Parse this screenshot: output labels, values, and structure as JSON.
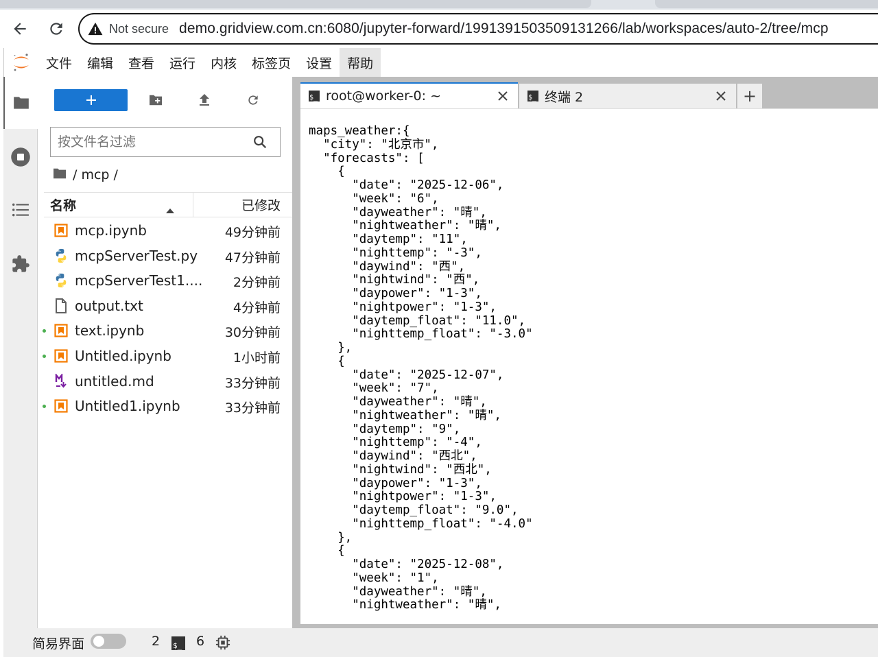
{
  "browser": {
    "not_secure_label": "Not secure",
    "url": "demo.gridview.com.cn:6080/jupyter-forward/1991391503509131266/lab/workspaces/auto-2/tree/mcp"
  },
  "menu": {
    "items": [
      "文件",
      "编辑",
      "查看",
      "运行",
      "内核",
      "标签页",
      "设置",
      "帮助"
    ],
    "active_item": "帮助"
  },
  "filebrowser": {
    "filter_placeholder": "按文件名过滤",
    "breadcrumb": "/ mcp /",
    "header_name": "名称",
    "header_modified": "已修改",
    "files": [
      {
        "name": "mcp.ipynb",
        "modified": "49分钟前",
        "type": "notebook",
        "running": false
      },
      {
        "name": "mcpServerTest.py",
        "modified": "47分钟前",
        "type": "python",
        "running": false
      },
      {
        "name": "mcpServerTest1....",
        "modified": "2分钟前",
        "type": "python",
        "running": false
      },
      {
        "name": "output.txt",
        "modified": "4分钟前",
        "type": "text",
        "running": false
      },
      {
        "name": "text.ipynb",
        "modified": "30分钟前",
        "type": "notebook",
        "running": true
      },
      {
        "name": "Untitled.ipynb",
        "modified": "1小时前",
        "type": "notebook",
        "running": true
      },
      {
        "name": "untitled.md",
        "modified": "33分钟前",
        "type": "markdown",
        "running": false
      },
      {
        "name": "Untitled1.ipynb",
        "modified": "33分钟前",
        "type": "notebook",
        "running": true
      }
    ]
  },
  "tabs": {
    "current": "root@worker-0: ~",
    "other": "终端 2",
    "add_label": "+"
  },
  "terminal": {
    "lines": [
      "maps_weather:{",
      "  \"city\": \"北京市\",",
      "  \"forecasts\": [",
      "    {",
      "      \"date\": \"2025-12-06\",",
      "      \"week\": \"6\",",
      "      \"dayweather\": \"晴\",",
      "      \"nightweather\": \"晴\",",
      "      \"daytemp\": \"11\",",
      "      \"nighttemp\": \"-3\",",
      "      \"daywind\": \"西\",",
      "      \"nightwind\": \"西\",",
      "      \"daypower\": \"1-3\",",
      "      \"nightpower\": \"1-3\",",
      "      \"daytemp_float\": \"11.0\",",
      "      \"nighttemp_float\": \"-3.0\"",
      "    },",
      "    {",
      "      \"date\": \"2025-12-07\",",
      "      \"week\": \"7\",",
      "      \"dayweather\": \"晴\",",
      "      \"nightweather\": \"晴\",",
      "      \"daytemp\": \"9\",",
      "      \"nighttemp\": \"-4\",",
      "      \"daywind\": \"西北\",",
      "      \"nightwind\": \"西北\",",
      "      \"daypower\": \"1-3\",",
      "      \"nightpower\": \"1-3\",",
      "      \"daytemp_float\": \"9.0\",",
      "      \"nighttemp_float\": \"-4.0\"",
      "    },",
      "    {",
      "      \"date\": \"2025-12-08\",",
      "      \"week\": \"1\",",
      "      \"dayweather\": \"晴\",",
      "      \"nightweather\": \"晴\","
    ]
  },
  "statusbar": {
    "simple_mode_label": "简易界面",
    "kernels_count": "2",
    "terminals_count": "6"
  },
  "colors": {
    "accent": "#1976d2",
    "notebook_icon": "#f57c00",
    "markdown_icon": "#7b1fa2",
    "running_dot": "#4caf50"
  }
}
